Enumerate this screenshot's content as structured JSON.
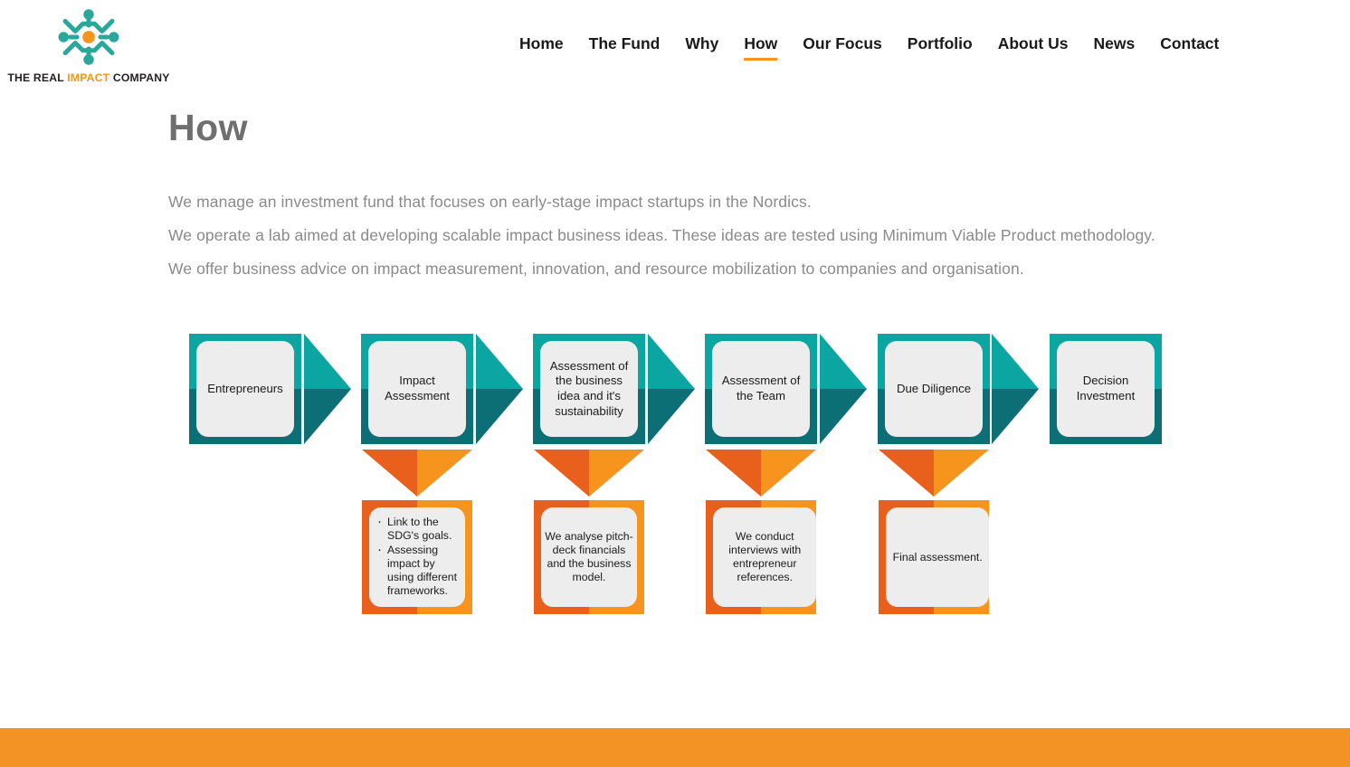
{
  "brand": {
    "name_prefix": "THE REAL ",
    "name_accent": "IMPACT",
    "name_suffix": " COMPANY",
    "logo_name": "people-circle-logo",
    "teal": "#2AA79B",
    "orange": "#F7941E"
  },
  "nav": {
    "items": [
      {
        "label": "Home",
        "active": false
      },
      {
        "label": "The Fund",
        "active": false
      },
      {
        "label": "Why",
        "active": false
      },
      {
        "label": "How",
        "active": true
      },
      {
        "label": "Our Focus",
        "active": false
      },
      {
        "label": "Portfolio",
        "active": false
      },
      {
        "label": "About Us",
        "active": false
      },
      {
        "label": "News",
        "active": false
      },
      {
        "label": "Contact",
        "active": false
      }
    ],
    "active_underline_color": "#F7941E"
  },
  "page": {
    "title": "How",
    "paragraphs": [
      "We manage an investment fund that focuses on early-stage impact startups in the Nordics.",
      "We operate a lab aimed at developing scalable impact business ideas. These ideas are tested using Minimum Viable Product methodology.",
      "We offer business advice on impact measurement, innovation, and resource mobilization to companies and organisation."
    ]
  },
  "chart_data": {
    "type": "diagram",
    "subtype": "process-flow",
    "title": "Investment process flow",
    "colors": {
      "teal_light": "#0CA6A2",
      "teal_dark": "#0B6F75",
      "orange_dark": "#E8601C",
      "orange_light": "#F7941E",
      "box_fill": "#EDEDED"
    },
    "steps": [
      {
        "id": "entrepreneurs",
        "label": "Entrepreneurs",
        "has_arrow_after": true,
        "note": null
      },
      {
        "id": "impact-assessment",
        "label": "Impact Assessment",
        "has_arrow_after": true,
        "note": {
          "type": "bullets",
          "items": [
            "Link to the SDG's goals.",
            "Assessing impact by using different frameworks."
          ]
        }
      },
      {
        "id": "business-idea-assessment",
        "label": "Assessment of the business idea and it's sustainability",
        "has_arrow_after": true,
        "note": {
          "type": "text",
          "text": "We analyse pitch-deck financials and the business model."
        }
      },
      {
        "id": "team-assessment",
        "label": "Assessment of the Team",
        "has_arrow_after": true,
        "note": {
          "type": "text",
          "text": "We conduct interviews with entrepreneur references."
        }
      },
      {
        "id": "due-diligence",
        "label": "Due Diligence",
        "has_arrow_after": true,
        "note": {
          "type": "text",
          "text": "Final assessment."
        }
      },
      {
        "id": "decision-investment",
        "label": "Decision Investment",
        "has_arrow_after": false,
        "note": null
      }
    ]
  },
  "footer": {
    "bar_color": "#F39325"
  }
}
